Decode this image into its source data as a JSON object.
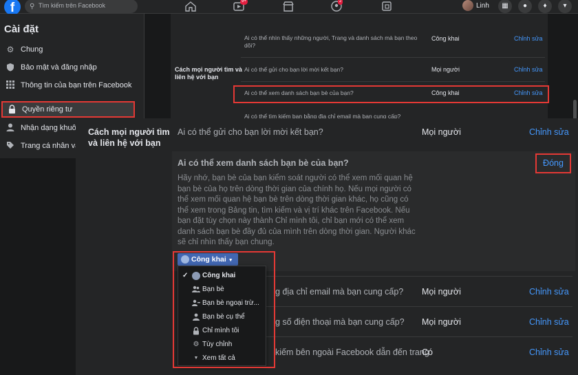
{
  "topbar": {
    "logo": "f",
    "search_placeholder": "Tìm kiếm trên Facebook",
    "notif_badge_1": "9+",
    "notif_badge_2": "2",
    "user_name": "Linh"
  },
  "sidebar": {
    "title": "Cài đặt",
    "items": [
      {
        "label": "Chung",
        "icon": "gear-icon"
      },
      {
        "label": "Bảo mật và đăng nhập",
        "icon": "shield-icon"
      },
      {
        "label": "Thông tin của bạn trên Facebook",
        "icon": "grid-icon"
      },
      {
        "label": "Quyền riêng tư",
        "icon": "lock-icon"
      },
      {
        "label": "Nhận dạng khuô",
        "icon": "person-icon"
      },
      {
        "label": "Trang cá nhân và",
        "icon": "tag-icon"
      }
    ]
  },
  "background_settings": {
    "row1_question": "Ai có thể nhìn thấy những người, Trang và danh sách mà bạn theo dõi?",
    "row1_value": "Công khai",
    "section_title": "Cách mọi người tìm và liên hệ với bạn",
    "row2_question": "Ai có thể gửi cho bạn lời mời kết bạn?",
    "row2_value": "Mọi người",
    "row3_question": "Ai có thể xem danh sách bạn bè của bạn?",
    "row3_value": "Công khai",
    "row4_question": "Ai có thể tìm kiếm bạn bằng địa chỉ email mà bạn cung cấp?",
    "edit_label": "Chỉnh sửa"
  },
  "zoomed_panel": {
    "section_title": "Cách mọi người tìm và liên hệ với bạn",
    "friend_request_question": "Ai có thể gửi cho bạn lời mời kết bạn?",
    "friend_request_value": "Mọi người",
    "edit_label": "Chỉnh sửa",
    "expanded_title": "Ai có thể xem danh sách bạn bè của bạn?",
    "expanded_body": "Hãy nhớ, bạn bè của bạn kiểm soát người có thể xem mối quan hệ bạn bè của họ trên dòng thời gian của chính họ. Nếu mọi người có thể xem mối quan hệ bạn bè trên dòng thời gian khác, họ cũng có thể xem trong Bảng tin, tìm kiếm và vị trí khác trên Facebook. Nếu bạn đặt tùy chọn này thành Chỉ mình tôi, chỉ bạn mới có thể xem danh sách bạn bè đầy đủ của mình trên dòng thời gian. Người khác sẽ chỉ nhìn thấy bạn chung.",
    "close_label": "Đóng",
    "audience_button": "Công khai",
    "email_question_partial": "g địa chỉ email mà bạn cung cấp?",
    "email_value": "Mọi người",
    "phone_question_partial": "g số điện thoại mà bạn cung cấp?",
    "phone_value": "Mọi người",
    "search_engine_question_partial": "kiếm bên ngoài Facebook dẫn đến trang",
    "search_engine_value": "Có"
  },
  "audience_dropdown": {
    "items": [
      {
        "label": "Công khai",
        "icon": "globe-icon",
        "selected": true
      },
      {
        "label": "Bạn bè",
        "icon": "friends-icon",
        "selected": false
      },
      {
        "label": "Bạn bè ngoại trừ...",
        "icon": "friends-except-icon",
        "selected": false
      },
      {
        "label": "Bạn bè cụ thể",
        "icon": "specific-friends-icon",
        "selected": false
      },
      {
        "label": "Chỉ mình tôi",
        "icon": "lock-icon",
        "selected": false
      },
      {
        "label": "Tùy chỉnh",
        "icon": "gear-icon",
        "selected": false
      },
      {
        "label": "Xem tất cả",
        "icon": "caret-down-icon",
        "selected": false
      }
    ]
  },
  "colors": {
    "accent": "#1877f2",
    "link": "#4599ff",
    "highlight": "#e53935",
    "background": "#18191a"
  }
}
